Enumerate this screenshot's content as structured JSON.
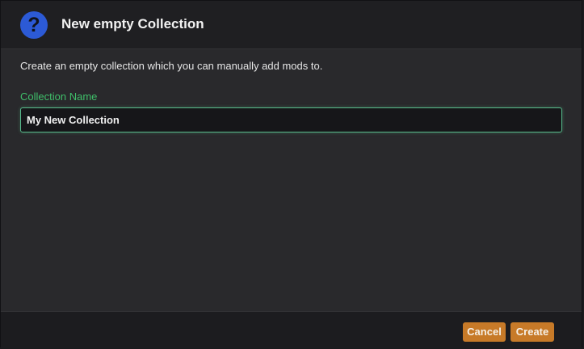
{
  "dialog": {
    "icon": "question-icon",
    "icon_glyph": "?",
    "icon_color": "#2c5ad6",
    "title": "New empty Collection",
    "description": "Create an empty collection which you can manually add mods to."
  },
  "form": {
    "collection_name_label": "Collection Name",
    "collection_name_value": "My New Collection",
    "label_color": "#3fbf6a"
  },
  "footer": {
    "cancel_label": "Cancel",
    "create_label": "Create",
    "button_color": "#c77a28"
  }
}
